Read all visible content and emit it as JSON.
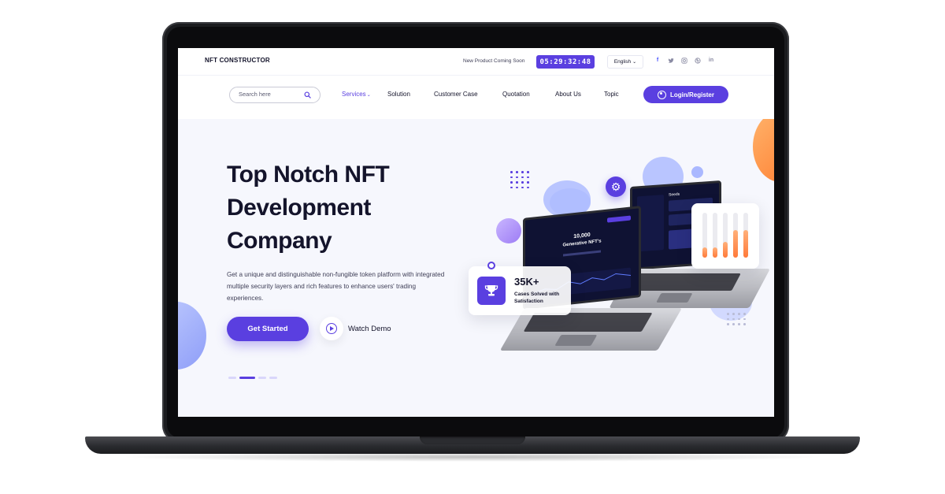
{
  "topbar": {
    "brand": "NFT CONSTRUCTOR",
    "coming_soon": "New Product Coming Soon",
    "countdown": "05:29:32:48",
    "language": "English",
    "socials": [
      "facebook-icon",
      "twitter-icon",
      "instagram-icon",
      "dribbble-icon",
      "linkedin-icon"
    ]
  },
  "nav": {
    "search_placeholder": "Search here",
    "items": [
      {
        "label": "Services",
        "active": true,
        "has_dropdown": true
      },
      {
        "label": "Solution"
      },
      {
        "label": "Customer Case"
      },
      {
        "label": "Quotation"
      },
      {
        "label": "About Us"
      },
      {
        "label": "Topic"
      }
    ],
    "login_label": "Login/Register"
  },
  "hero": {
    "title_lines": [
      "Top Notch NFT",
      "Development",
      "Company"
    ],
    "description": "Get a unique and distinguishable non-fungible token platform with integrated multiple security layers and rich features to enhance users' trading experiences.",
    "cta_label": "Get Started",
    "watch_label": "Watch Demo",
    "slides_total": 4,
    "slide_active": 2
  },
  "stat_card": {
    "value": "35K+",
    "label": "Cases Solved with Satisfaction"
  },
  "mini_screen": {
    "headline_num": "10,000",
    "headline_text": "Generative NFT's",
    "side_title": "Seeds"
  },
  "bar_card": {
    "levels": [
      0.22,
      0.22,
      0.35,
      0.62,
      0.62
    ]
  },
  "colors": {
    "accent": "#5a3fe0",
    "orange": "#ff7a3a",
    "text": "#14142b"
  }
}
